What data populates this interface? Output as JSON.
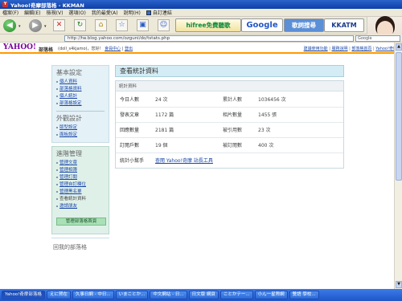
{
  "window": {
    "title": "Yahoo!奇摩部落格 - KKMAN"
  },
  "menu": [
    "檔案(F)",
    "編輯(E)",
    "檢視(V)",
    "選項(O)",
    "我的最愛(A)",
    "說明(H)",
    "自訂連結"
  ],
  "toolbar_ads": {
    "hifree": "hifree免費聽歌",
    "google": "Google",
    "kakaku": "歌詞搜尋",
    "kkatm": "KKATM"
  },
  "address": {
    "url": "http://tw.blog.yahoo.com/ozguni/do/tstats.php",
    "search_label": "Google"
  },
  "header": {
    "logo": "YAHOO!",
    "logo_sub": "奇摩",
    "blog_word": "部落格",
    "user": "(doll_s4kjamo)，您好！",
    "member_center": "會員中心",
    "logout": "登出",
    "links": [
      "建議使用功能",
      "服務說明",
      "部落格首頁",
      "Yahoo!奇摩"
    ]
  },
  "sidebar": {
    "basic_title": "基本設定",
    "basic_items": [
      "個人資料",
      "部落格資料",
      "個人統計",
      "部落格設定"
    ],
    "appearance_title": "外觀設計",
    "appearance_items": [
      "版型設定",
      "面板設定"
    ],
    "mgmt_title": "進階管理",
    "mgmt_items": [
      "管理文章",
      "管理相簿",
      "管理訂閱",
      "管理自訂欄位",
      "管理黑名單",
      "查看統計資料",
      "邀請朋友"
    ],
    "home_button": "管理部落格首頁",
    "bottom_title": "回我的部落格"
  },
  "main": {
    "title": "查看統計資料",
    "stats_header": "統計資料",
    "rows": [
      {
        "l1": "今日人數",
        "v1": "24 次",
        "l2": "累計人數",
        "v2": "1036456 次"
      },
      {
        "l1": "發表文章",
        "v1": "1172 篇",
        "l2": "相片數量",
        "v2": "1455 張"
      },
      {
        "l1": "回應數量",
        "v1": "2181 篇",
        "l2": "被引用數",
        "v2": "23 次"
      },
      {
        "l1": "訂閱戶數",
        "v1": "19 個",
        "l2": "被訂閱數",
        "v2": "400 次"
      }
    ],
    "helper_label": "統計小幫手",
    "helper_link": "查閱 Yahoo!奇摩 站長工具"
  },
  "taskbar": [
    "Yahoo!奇摩部落格",
    "えに賀在",
    "久事日網 - 中日...",
    "いまことか...",
    "中文網站 - 日...",
    "日文版 網頁",
    "ことかテー...",
    "小ん一星際網",
    "雙語 學校..."
  ]
}
